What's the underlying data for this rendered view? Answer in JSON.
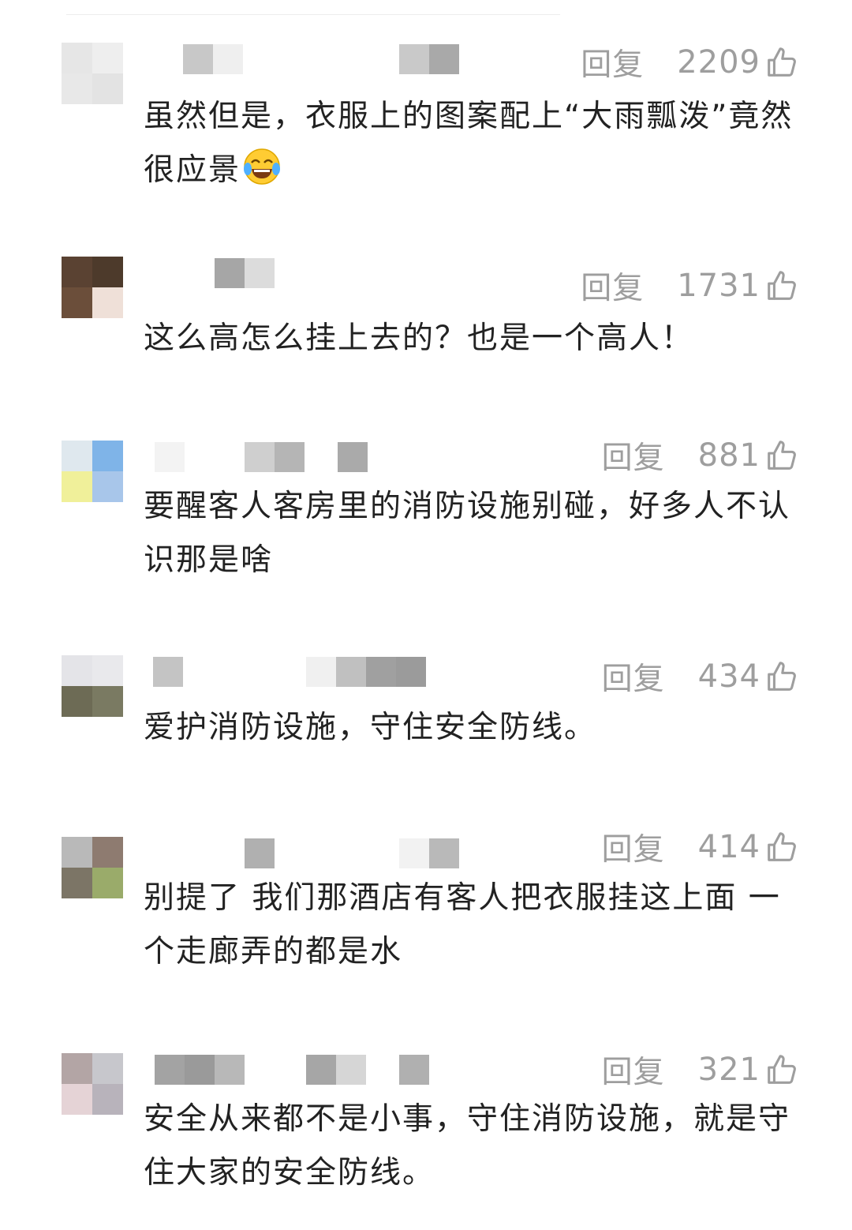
{
  "comments": [
    {
      "reply_label": "回复",
      "likes": "2209",
      "text": "虽然但是，衣服上的图案配上“大雨瓢泼”竟然很应景",
      "emoji": "laughing-tears-emoji",
      "avatar_colors": [
        "#e6e6e6",
        "#eeeeee",
        "#e8e8e8",
        "#e3e3e3"
      ]
    },
    {
      "reply_label": "回复",
      "likes": "1731",
      "text": "这么高怎么挂上去的？也是一个高人！",
      "avatar_colors": [
        "#5a4232",
        "#4d3a2b",
        "#6b4e3a",
        "#efe0d8"
      ]
    },
    {
      "reply_label": "回复",
      "likes": "881",
      "text": "要醒客人客房里的消防设施别碰，好多人不认识那是啥",
      "avatar_colors": [
        "#dfe8ee",
        "#7fb4e8",
        "#f0f09a",
        "#a8c6ea"
      ]
    },
    {
      "reply_label": "回复",
      "likes": "434",
      "text": "爱护消防设施，守住安全防线。",
      "avatar_colors": [
        "#e4e4e8",
        "#e9e9ec",
        "#6d6b55",
        "#7a7a62"
      ]
    },
    {
      "reply_label": "回复",
      "likes": "414",
      "text": "别提了 我们那酒店有客人把衣服挂这上面 一个走廊弄的都是水",
      "avatar_colors": [
        "#b9b9b9",
        "#8e7b70",
        "#7c7566",
        "#9aab6a"
      ]
    },
    {
      "reply_label": "回复",
      "likes": "321",
      "text": "安全从来都不是小事，守住消防设施，就是守住大家的安全防线。",
      "avatar_colors": [
        "#b3a5a5",
        "#c7c7cc",
        "#e5d3d6",
        "#b8b3bb"
      ]
    }
  ]
}
